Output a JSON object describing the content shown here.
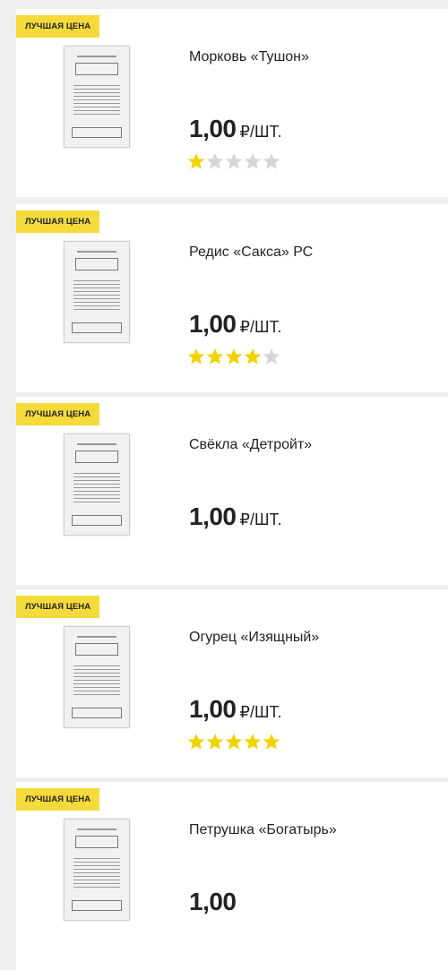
{
  "colors": {
    "badge": "#f4da3a",
    "star_on": "#f2d200",
    "star_off": "#d6d6d6",
    "background": "#efefef"
  },
  "products": [
    {
      "badge": "ЛУЧШАЯ ЦЕНА",
      "title": "Морковь «Тушон»",
      "price": "1,00",
      "unit": "₽/ШТ.",
      "rating": 1,
      "image_icon": "seed-packet-icon"
    },
    {
      "badge": "ЛУЧШАЯ ЦЕНА",
      "title": "Редис «Сакса» РС",
      "price": "1,00",
      "unit": "₽/ШТ.",
      "rating": 4,
      "image_icon": "seed-packet-icon"
    },
    {
      "badge": "ЛУЧШАЯ ЦЕНА",
      "title": "Свёкла «Детройт»",
      "price": "1,00",
      "unit": "₽/ШТ.",
      "rating": 0,
      "image_icon": "seed-packet-icon"
    },
    {
      "badge": "ЛУЧШАЯ ЦЕНА",
      "title": "Огурец «Изящный»",
      "price": "1,00",
      "unit": "₽/ШТ.",
      "rating": 5,
      "image_icon": "seed-packet-icon"
    },
    {
      "badge": "ЛУЧШАЯ ЦЕНА",
      "title": "Петрушка «Богатырь»",
      "price": "1,00",
      "unit": "",
      "rating": 0,
      "image_icon": "seed-packet-icon"
    }
  ]
}
